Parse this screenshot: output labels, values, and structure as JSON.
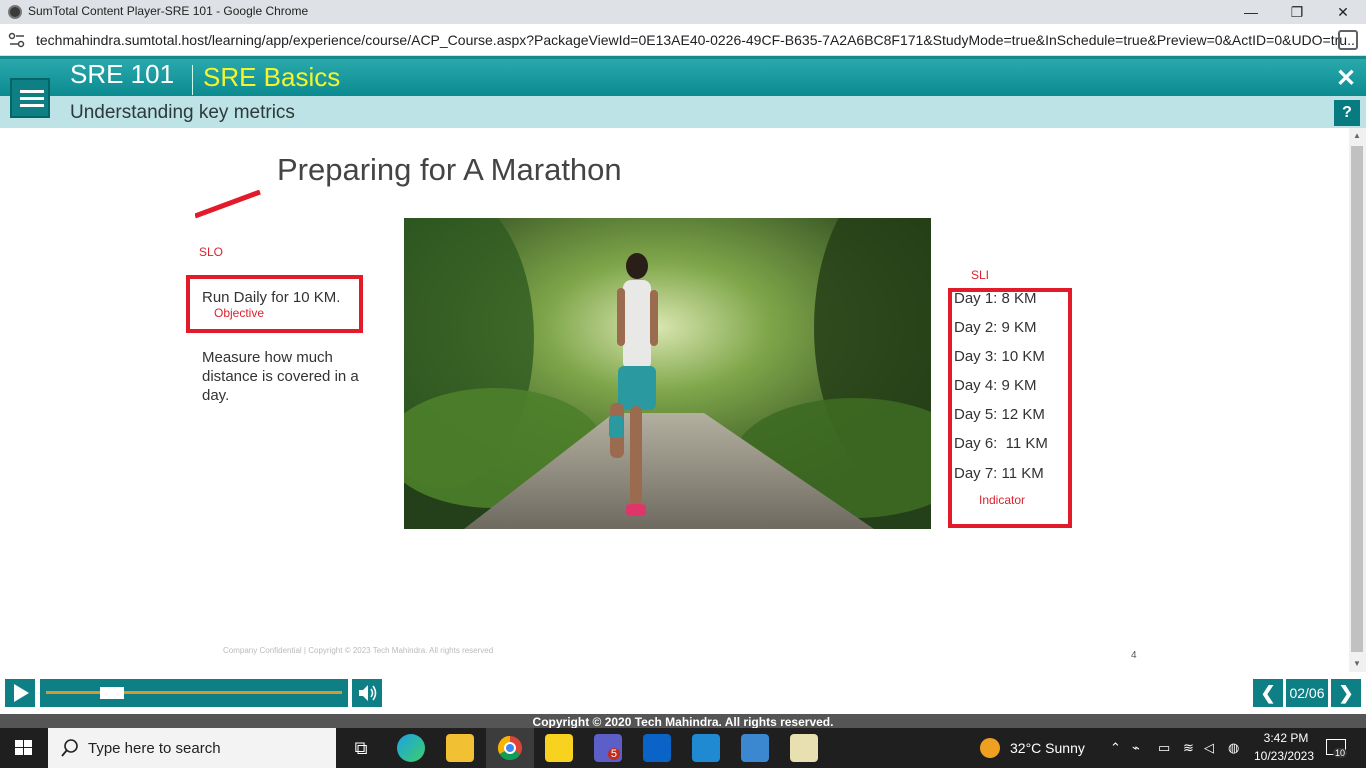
{
  "window": {
    "title": "SumTotal Content Player-SRE 101 - Google Chrome",
    "url": "techmahindra.sumtotal.host/learning/app/experience/course/ACP_Course.aspx?PackageViewId=0E13AE40-0226-49CF-B635-7A2A6BC8F171&StudyMode=true&InSchedule=true&Preview=0&ActID=0&UDO=tru..."
  },
  "course": {
    "code": "SRE 101",
    "title": "SRE Basics",
    "subtitle": "Understanding key metrics",
    "close_label": "✕",
    "help_label": "?"
  },
  "slide": {
    "title": "Preparing for A Marathon",
    "slo_label": "SLO",
    "objective_main": "Run Daily for 10 KM.",
    "objective_annot": "Objective",
    "measure_text": "Measure how much distance is covered in a day.",
    "sli_label": "SLI",
    "days": [
      "Day 1: 8 KM",
      "Day 2: 9 KM",
      "Day 3: 10 KM",
      "Day 4: 9 KM",
      "Day 5: 12 KM",
      "Day 6:  11 KM",
      "Day 7: 11 KM"
    ],
    "indicator_annot": "Indicator",
    "footer": "Company Confidential | Copyright © 2023 Tech Mahindra. All rights reserved",
    "page_number": "4"
  },
  "player": {
    "page_indicator": "02/06",
    "progress_fraction": 0.2,
    "copyright": "Copyright © 2020 Tech Mahindra. All rights reserved."
  },
  "taskbar": {
    "search_placeholder": "Type here to search",
    "teams_badge": "5",
    "weather": "32°C  Sunny",
    "time": "3:42 PM",
    "date": "10/23/2023",
    "notification_count": "10"
  }
}
